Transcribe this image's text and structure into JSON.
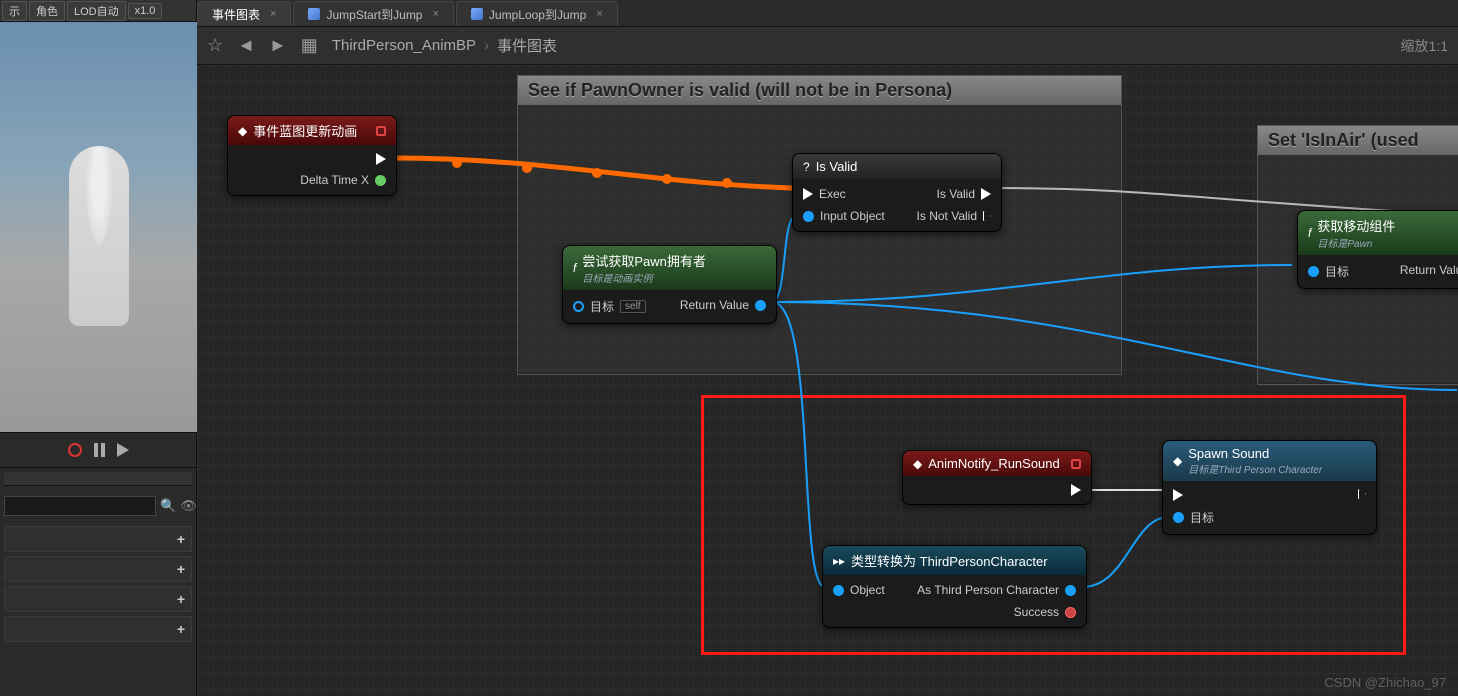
{
  "left_toolbar": {
    "b1": "示",
    "b2": "角色",
    "b3": "LOD自动",
    "b4": "x1.0"
  },
  "search": {
    "placeholder": ""
  },
  "tabs": [
    {
      "label": "事件图表",
      "active": true
    },
    {
      "label": "JumpStart到Jump",
      "active": false
    },
    {
      "label": "JumpLoop到Jump",
      "active": false
    }
  ],
  "breadcrumb": {
    "asset": "ThirdPerson_AnimBP",
    "graph": "事件图表"
  },
  "zoom": "缩放1:1",
  "comments": {
    "c1": "See if PawnOwner is valid (will not be in Persona)",
    "c2": "Set 'IsInAir' (used"
  },
  "nodes": {
    "update": {
      "title": "事件蓝图更新动画",
      "pin_delta": "Delta Time X"
    },
    "isvalid": {
      "title": "Is Valid",
      "exec": "Exec",
      "input": "Input Object",
      "out1": "Is Valid",
      "out2": "Is Not Valid"
    },
    "getpawn": {
      "title": "尝试获取Pawn拥有者",
      "sub": "目标是动画实例",
      "target": "目标",
      "self": "self",
      "ret": "Return Value"
    },
    "getmove": {
      "title": "获取移动组件",
      "sub": "目标是Pawn",
      "target": "目标",
      "ret": "Return Value"
    },
    "animnotify": {
      "title": "AnimNotify_RunSound"
    },
    "cast": {
      "title": "类型转换为 ThirdPersonCharacter",
      "obj": "Object",
      "as": "As Third Person Character",
      "succ": "Success"
    },
    "spawn": {
      "title": "Spawn Sound",
      "sub": "目标是Third Person Character",
      "target": "目标"
    }
  },
  "watermark": "CSDN @Zhichao_97"
}
